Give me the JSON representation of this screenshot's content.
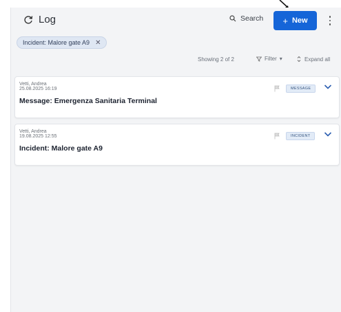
{
  "header": {
    "title": "Log",
    "search_label": "Search",
    "new_label": "New"
  },
  "filter_chip": {
    "label": "Incident: Malore gate A9"
  },
  "toolbar": {
    "showing": "Showing 2 of 2",
    "filter_label": "Filter",
    "expand_label": "Expand all"
  },
  "entries": [
    {
      "author": "Vetti, Andrea",
      "date": "25.08.2025 16:19",
      "title": "Message: Emergenza Sanitaria Terminal",
      "badge": "MESSAGE"
    },
    {
      "author": "Vetti, Andrea",
      "date": "19.08.2025 12:55",
      "title": "Incident: Malore gate A9",
      "badge": "INCIDENT"
    }
  ],
  "colors": {
    "accent": "#1565d8",
    "panel_bg": "#f3f4f6",
    "badge_bg": "#e2ebf7"
  }
}
